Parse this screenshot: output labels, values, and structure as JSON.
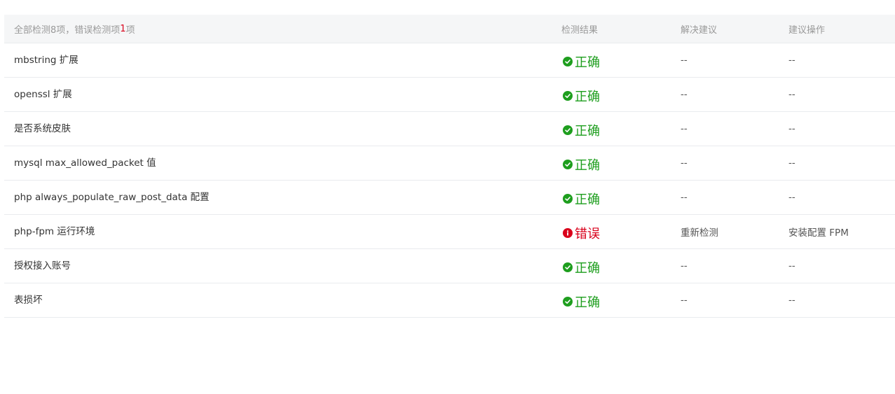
{
  "header": {
    "summary_prefix": "全部检测8项，错误检测项",
    "error_count": "1",
    "summary_suffix": "项",
    "col_result": "检测结果",
    "col_solution": "解决建议",
    "col_action": "建议操作"
  },
  "status_colors": {
    "ok": "#1e9e1e",
    "error": "#d9001b"
  },
  "rows": [
    {
      "name": "mbstring 扩展",
      "status": "ok",
      "icon": "check-circle-icon",
      "result": "正确",
      "solution": "--",
      "action": "--"
    },
    {
      "name": "openssl 扩展",
      "status": "ok",
      "icon": "check-circle-icon",
      "result": "正确",
      "solution": "--",
      "action": "--"
    },
    {
      "name": "是否系统皮肤",
      "status": "ok",
      "icon": "check-circle-icon",
      "result": "正确",
      "solution": "--",
      "action": "--"
    },
    {
      "name": "mysql max_allowed_packet 值",
      "status": "ok",
      "icon": "check-circle-icon",
      "result": "正确",
      "solution": "--",
      "action": "--"
    },
    {
      "name": "php always_populate_raw_post_data 配置",
      "status": "ok",
      "icon": "check-circle-icon",
      "result": "正确",
      "solution": "--",
      "action": "--"
    },
    {
      "name": "php-fpm 运行环境",
      "status": "error",
      "icon": "error-circle-icon",
      "result": "错误",
      "solution": "重新检测",
      "action": "安装配置 FPM"
    },
    {
      "name": "授权接入账号",
      "status": "ok",
      "icon": "check-circle-icon",
      "result": "正确",
      "solution": "--",
      "action": "--"
    },
    {
      "name": "表损坏",
      "status": "ok",
      "icon": "check-circle-icon",
      "result": "正确",
      "solution": "--",
      "action": "--"
    }
  ]
}
